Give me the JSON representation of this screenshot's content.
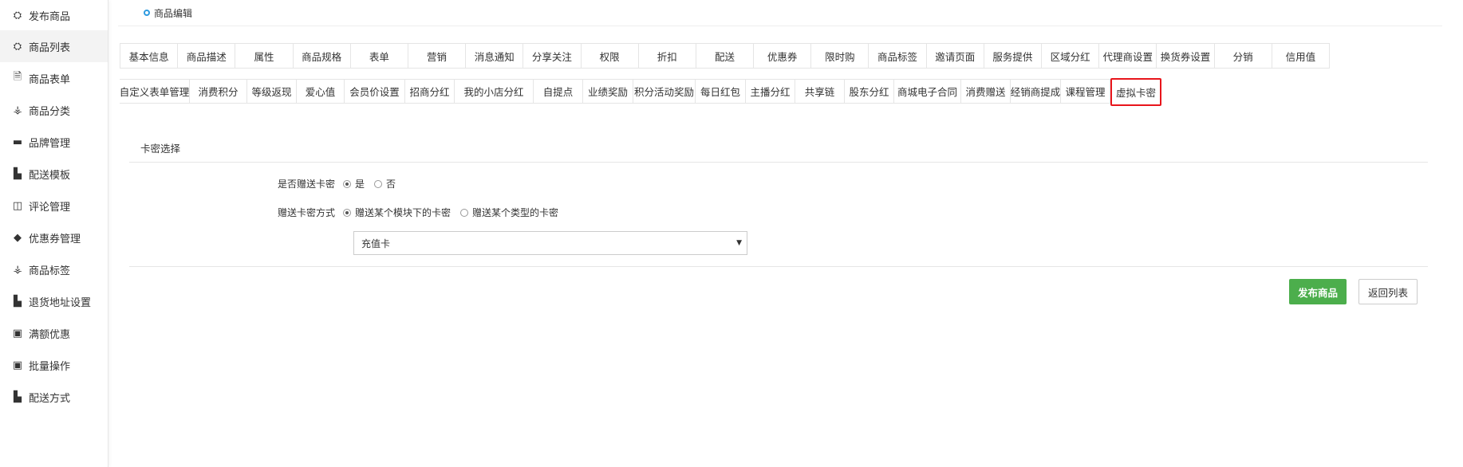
{
  "sidebar": {
    "items": [
      {
        "label": "发布商品",
        "icon": "cubes-icon",
        "glyph": "⛭"
      },
      {
        "label": "商品列表",
        "icon": "cubes-icon",
        "glyph": "⛭",
        "active": true
      },
      {
        "label": "商品表单",
        "icon": "document-icon",
        "glyph": "🗎"
      },
      {
        "label": "商品分类",
        "icon": "sitemap-icon",
        "glyph": "⚶"
      },
      {
        "label": "品牌管理",
        "icon": "briefcase-icon",
        "glyph": "▬"
      },
      {
        "label": "配送模板",
        "icon": "truck-icon",
        "glyph": "▙"
      },
      {
        "label": "评论管理",
        "icon": "columns-icon",
        "glyph": "◫"
      },
      {
        "label": "优惠券管理",
        "icon": "tags-icon",
        "glyph": "◆"
      },
      {
        "label": "商品标签",
        "icon": "sitemap-icon",
        "glyph": "⚶"
      },
      {
        "label": "退货地址设置",
        "icon": "truck-icon",
        "glyph": "▙"
      },
      {
        "label": "满额优惠",
        "icon": "gift-icon",
        "glyph": "▣"
      },
      {
        "label": "批量操作",
        "icon": "gift-icon",
        "glyph": "▣"
      },
      {
        "label": "配送方式",
        "icon": "truck-icon",
        "glyph": "▙"
      }
    ]
  },
  "header": {
    "title": "商品编辑"
  },
  "tabs_row1": [
    "基本信息",
    "商品描述",
    "属性",
    "商品规格",
    "表单",
    "营销",
    "消息通知",
    "分享关注",
    "权限",
    "折扣",
    "配送",
    "优惠券",
    "限时购",
    "商品标签",
    "邀请页面",
    "服务提供",
    "区域分红",
    "代理商设置",
    "换货券设置",
    "分销",
    "信用值"
  ],
  "tabs_row2": [
    "自定义表单管理",
    "消费积分",
    "等级返现",
    "爱心值",
    "会员价设置",
    "招商分红",
    "我的小店分红",
    "自提点",
    "业绩奖励",
    "积分活动奖励",
    "每日红包",
    "主播分红",
    "共享链",
    "股东分红",
    "商城电子合同",
    "消费赠送",
    "经销商提成",
    "课程管理",
    "虚拟卡密"
  ],
  "tabs_row2_selected": "虚拟卡密",
  "form": {
    "section_title": "卡密选择",
    "gift_label": "是否赠送卡密",
    "gift_yes": "是",
    "gift_no": "否",
    "mode_label": "赠送卡密方式",
    "mode_module": "赠送某个模块下的卡密",
    "mode_type": "赠送某个类型的卡密",
    "select_value": "充值卡"
  },
  "buttons": {
    "publish": "发布商品",
    "back": "返回列表"
  },
  "colors": {
    "primary": "#4cae4c",
    "selected_border": "#e8151b",
    "accent": "#2e9be0"
  }
}
